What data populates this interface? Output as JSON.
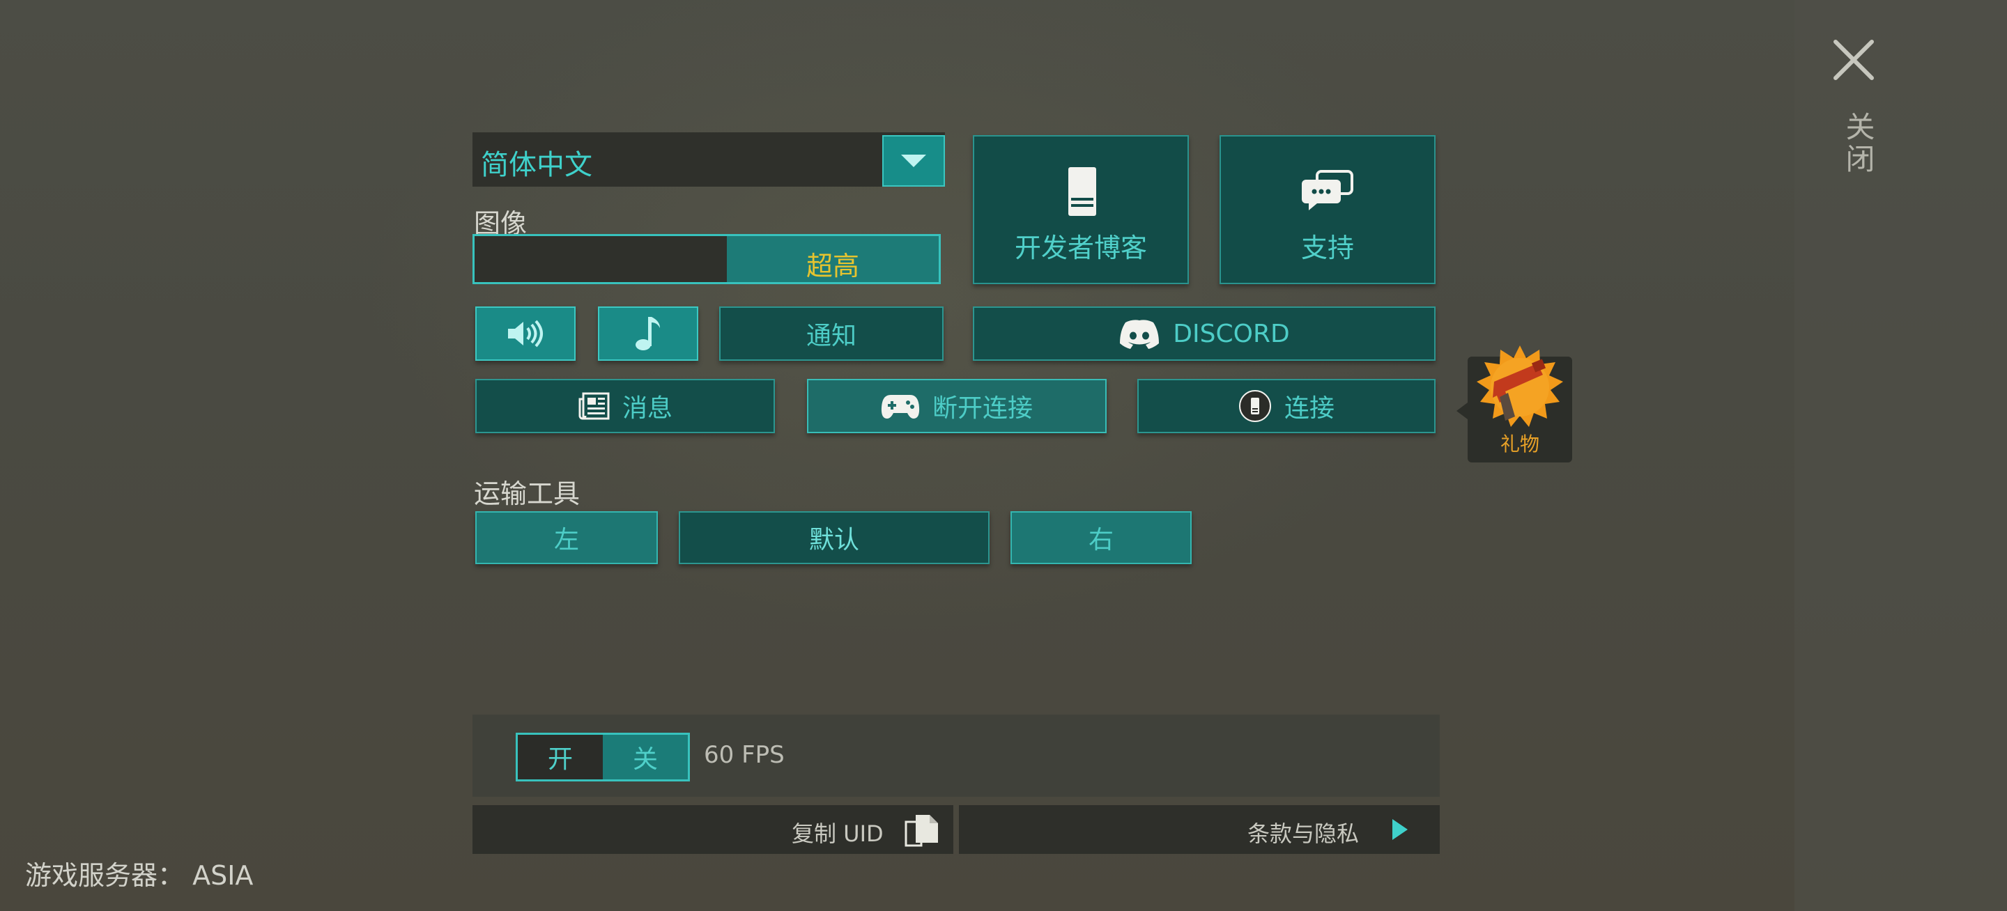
{
  "close": {
    "icon": "close-icon",
    "label": "关闭"
  },
  "language": {
    "selected": "简体中文"
  },
  "graphics": {
    "label": "图像",
    "selected_option": "超高"
  },
  "tiles": {
    "dev_blog": "开发者博客",
    "support": "支持"
  },
  "row1": {
    "notify": "通知",
    "discord": "DISCORD"
  },
  "row2": {
    "news": "消息",
    "disconnect": "断开连接",
    "connect": "连接"
  },
  "gift": {
    "label": "礼物"
  },
  "vehicle": {
    "label": "运输工具",
    "left": "左",
    "default": "默认",
    "right": "右"
  },
  "fps": {
    "on": "开",
    "off": "关",
    "value": "60 FPS"
  },
  "footer": {
    "copy_uid": "复制 UID",
    "terms": "条款与隐私"
  },
  "server": {
    "text": "游戏服务器： ASIA"
  },
  "colors": {
    "accent": "#3fd1cb",
    "tile_bg": "#124c48",
    "highlight_text": "#e7c42e",
    "gift_text": "#e8a127"
  }
}
